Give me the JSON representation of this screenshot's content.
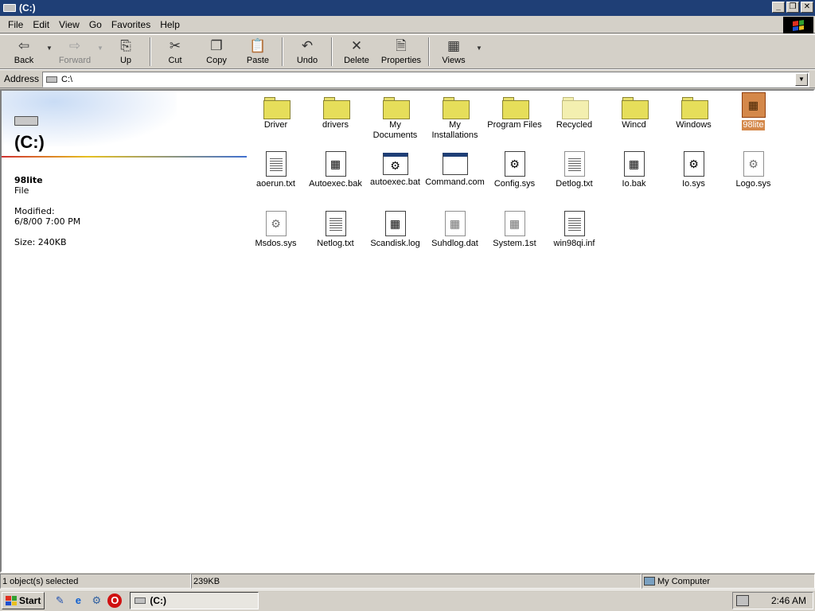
{
  "window": {
    "title": "(C:)"
  },
  "menu": [
    "File",
    "Edit",
    "View",
    "Go",
    "Favorites",
    "Help"
  ],
  "toolbar": {
    "back": "Back",
    "forward": "Forward",
    "up": "Up",
    "cut": "Cut",
    "copy": "Copy",
    "paste": "Paste",
    "undo": "Undo",
    "delete": "Delete",
    "properties": "Properties",
    "views": "Views"
  },
  "address": {
    "label": "Address",
    "value": "C:\\"
  },
  "webview": {
    "drive_title": "(C:)",
    "item_name": "98lite",
    "item_type": "File",
    "modified_label": "Modified:",
    "modified_value": "6/8/00 7:00 PM",
    "size": "Size: 240KB"
  },
  "items": [
    {
      "label": "Driver",
      "kind": "folder"
    },
    {
      "label": "drivers",
      "kind": "folder"
    },
    {
      "label": "My Documents",
      "kind": "folder"
    },
    {
      "label": "My Installations",
      "kind": "folder"
    },
    {
      "label": "Program Files",
      "kind": "folder"
    },
    {
      "label": "Recycled",
      "kind": "folder-light"
    },
    {
      "label": "Wincd",
      "kind": "folder"
    },
    {
      "label": "Windows",
      "kind": "folder"
    },
    {
      "label": "98lite",
      "kind": "special",
      "selected": true
    },
    {
      "label": "aoerun.txt",
      "kind": "text"
    },
    {
      "label": "Autoexec.bak",
      "kind": "win-doc"
    },
    {
      "label": "autoexec.bat",
      "kind": "window-gear"
    },
    {
      "label": "Command.com",
      "kind": "window"
    },
    {
      "label": "Config.sys",
      "kind": "gear-doc"
    },
    {
      "label": "Detlog.txt",
      "kind": "text-light"
    },
    {
      "label": "Io.bak",
      "kind": "win-doc"
    },
    {
      "label": "Io.sys",
      "kind": "gear-doc"
    },
    {
      "label": "Logo.sys",
      "kind": "sys"
    },
    {
      "label": "Msdos.sys",
      "kind": "sys"
    },
    {
      "label": "Netlog.txt",
      "kind": "text"
    },
    {
      "label": "Scandisk.log",
      "kind": "win-doc"
    },
    {
      "label": "Suhdlog.dat",
      "kind": "sys-win"
    },
    {
      "label": "System.1st",
      "kind": "sys-win"
    },
    {
      "label": "win98qi.inf",
      "kind": "inf"
    }
  ],
  "status": {
    "selection": "1 object(s) selected",
    "size": "239KB",
    "zone": "My Computer"
  },
  "taskbar": {
    "start": "Start",
    "task": "(C:)",
    "clock": "2:46 AM"
  }
}
